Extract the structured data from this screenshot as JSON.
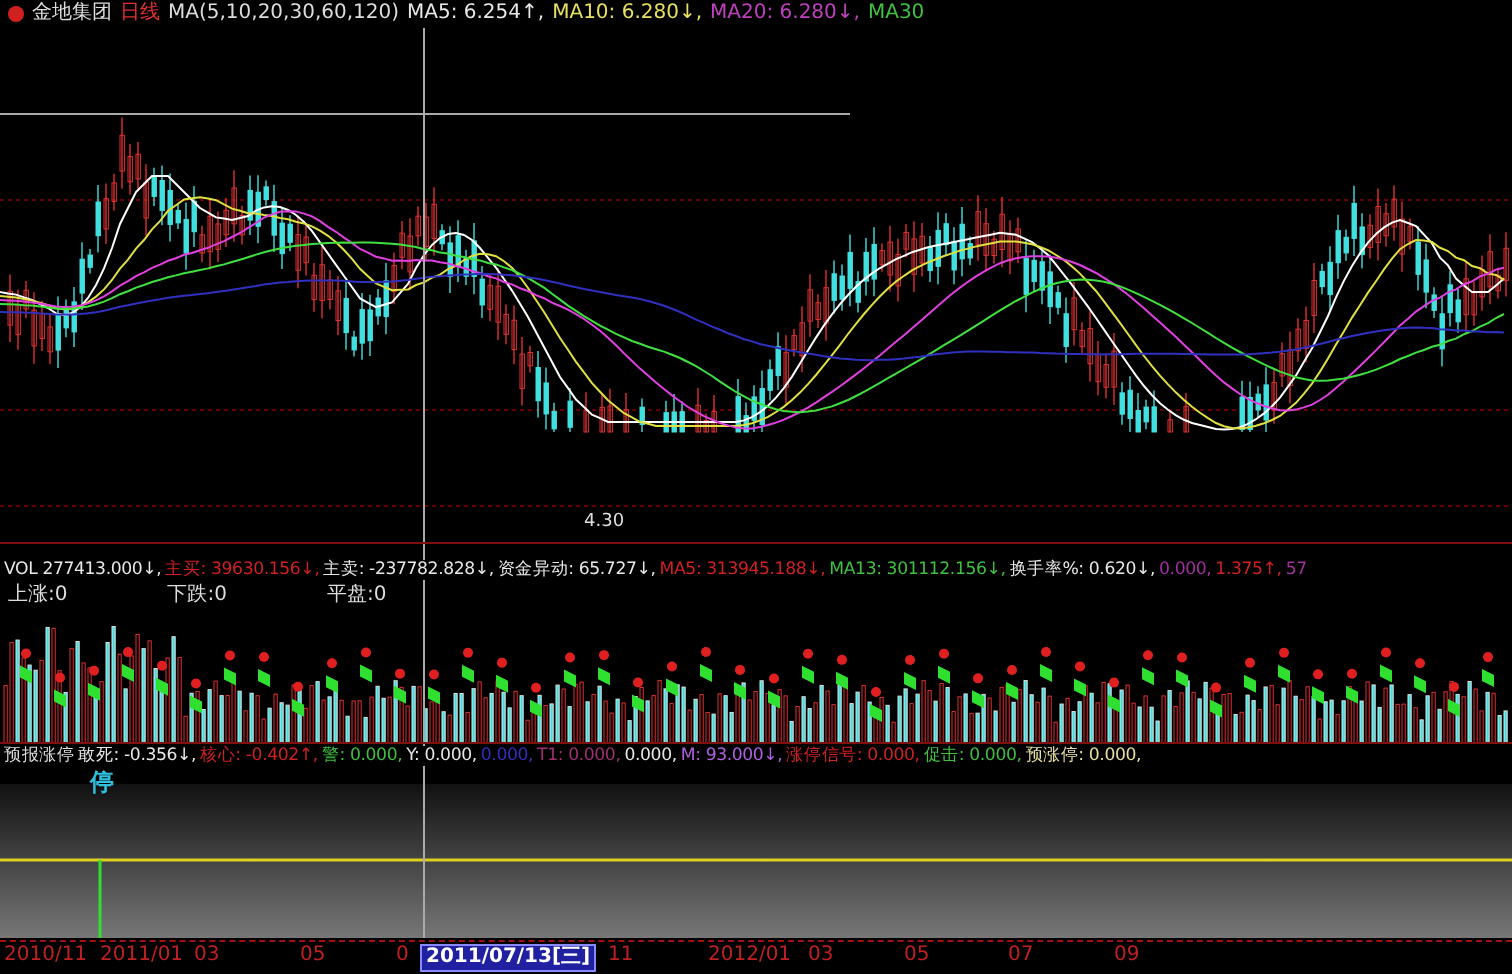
{
  "header": {
    "stock_name": "金地集团",
    "period": "日线",
    "ma_label": "MA(5,10,20,30,60,120)",
    "ma_items": [
      {
        "text": "MA5: 6.254↑,",
        "color": "#e8e8e8"
      },
      {
        "text": "MA10: 6.280↓,",
        "color": "#e8e060"
      },
      {
        "text": "MA20: 6.280↓,",
        "color": "#c040c0"
      },
      {
        "text": "MA30",
        "color": "#40c040"
      }
    ]
  },
  "volume_panel": {
    "items": [
      {
        "text": "VOL 277413.000↓,",
        "color": "#e8e8e8"
      },
      {
        "text": "主买: 39630.156↓,",
        "color": "#d02020"
      },
      {
        "text": "主卖: -237782.828↓,",
        "color": "#e8e8e8"
      },
      {
        "text": "资金异动: 65.727↓,",
        "color": "#e8e8e8"
      },
      {
        "text": "MA5: 313945.188↓,",
        "color": "#d02020"
      },
      {
        "text": "MA13: 301112.156↓,",
        "color": "#40c040"
      },
      {
        "text": "换手率%: 0.620↓,",
        "color": "#e8e8e8"
      },
      {
        "text": "0.000,",
        "color": "#a030a0"
      },
      {
        "text": "1.375↑,",
        "color": "#d02020"
      },
      {
        "text": "57",
        "color": "#a030a0"
      }
    ],
    "counts": [
      "上涨:0",
      "下跌:0",
      "平盘:0"
    ],
    "marker": "4.30"
  },
  "indicator_panel": {
    "title": "预报涨停",
    "items": [
      {
        "text": "敢死: -0.356↓,",
        "color": "#e8e8e8"
      },
      {
        "text": "核心: -0.402↑,",
        "color": "#d02020"
      },
      {
        "text": "警: 0.000,",
        "color": "#40c040"
      },
      {
        "text": "Y: 0.000,",
        "color": "#e8e8e8"
      },
      {
        "text": "0.000,",
        "color": "#3030c0"
      },
      {
        "text": "T1: 0.000,",
        "color": "#a03070"
      },
      {
        "text": "0.000,",
        "color": "#e8e8e8"
      },
      {
        "text": "M: 93.000↓,",
        "color": "#b060e0"
      },
      {
        "text": "涨停信号: 0.000,",
        "color": "#d02020"
      },
      {
        "text": "促击: 0.000,",
        "color": "#40c040"
      },
      {
        "text": "预涨停: 0.000,",
        "color": "#e8e0a0"
      }
    ],
    "signal": "停"
  },
  "date_axis": {
    "labels": [
      {
        "text": "2010/11",
        "selected": false
      },
      {
        "text": "2011/01",
        "selected": false
      },
      {
        "text": "03",
        "selected": false
      },
      {
        "text": "05",
        "selected": false
      },
      {
        "text": "0",
        "selected": false
      },
      {
        "text": "2011/07/13[三]",
        "selected": true
      },
      {
        "text": "11",
        "selected": false
      },
      {
        "text": "2012/01",
        "selected": false
      },
      {
        "text": "03",
        "selected": false
      },
      {
        "text": "05",
        "selected": false
      },
      {
        "text": "07",
        "selected": false
      },
      {
        "text": "09",
        "selected": false
      }
    ]
  }
}
